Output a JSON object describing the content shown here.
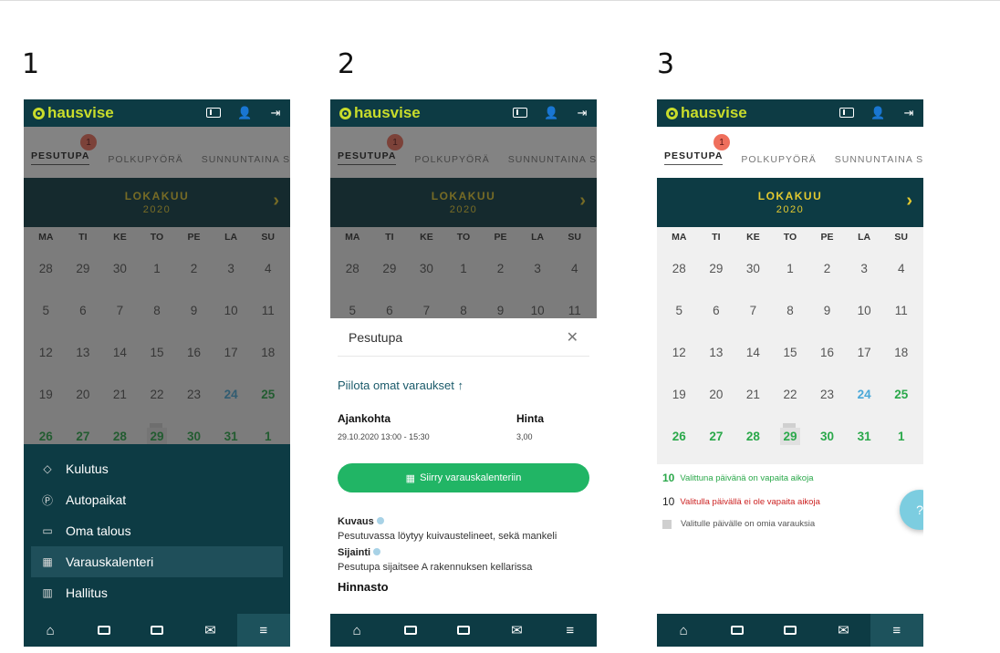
{
  "steps": [
    "1",
    "2",
    "3"
  ],
  "app": {
    "logo_text": "hausvise"
  },
  "tabs": [
    {
      "label": "PESUTUPA",
      "badge": "1"
    },
    {
      "label": "POLKUPYÖRÄ"
    },
    {
      "label": "SUNNUNTAINA SAUNA"
    }
  ],
  "calendar": {
    "month": "LOKAKUU",
    "year": "2020",
    "next_icon": "chevron-right-icon",
    "weekdays": [
      "MA",
      "TI",
      "KE",
      "TO",
      "PE",
      "LA",
      "SU"
    ],
    "weeks": [
      [
        "28",
        "29",
        "30",
        "1",
        "2",
        "3",
        "4"
      ],
      [
        "5",
        "6",
        "7",
        "8",
        "9",
        "10",
        "11"
      ],
      [
        "12",
        "13",
        "14",
        "15",
        "16",
        "17",
        "18"
      ],
      [
        "19",
        "20",
        "21",
        "22",
        "23",
        "24",
        "25"
      ],
      [
        "26",
        "27",
        "28",
        "29",
        "30",
        "31",
        "1"
      ]
    ]
  },
  "legend": {
    "free_num": "10",
    "free_text": "Valittuna päivänä on vapaita aikoja",
    "busy_num": "10",
    "busy_text": "Valitulla päivällä ei ole vapaita aikoja",
    "own_text": "Valitulle päivälle on omia varauksia"
  },
  "fab": {
    "label": "?"
  },
  "drawer": {
    "items": [
      {
        "label": "Kulutus",
        "icon": "drop-icon"
      },
      {
        "label": "Autopaikat",
        "icon": "parking-icon"
      },
      {
        "label": "Oma talous",
        "icon": "money-icon"
      },
      {
        "label": "Varauskalenteri",
        "icon": "calendar-icon"
      },
      {
        "label": "Hallitus",
        "icon": "bank-icon"
      }
    ]
  },
  "sheet": {
    "title": "Pesutupa",
    "hide_link": "Piilota omat varaukset ↑",
    "col_time": "Ajankohta",
    "col_price": "Hinta",
    "time_value": "29.10.2020 13:00 - 15:30",
    "price_value": "3,00",
    "cta": "Siirry varauskalenteriin",
    "desc_title": "Kuvaus",
    "desc_text": "Pesutuvassa löytyy kuivaustelineet, sekä mankeli",
    "loc_title": "Sijainti",
    "loc_text": "Pesutupa sijaitsee A rakennuksen kellarissa",
    "pricing_title": "Hinnasto"
  },
  "colors": {
    "header": "#0d3b44",
    "accent_yellow": "#e3c930",
    "logo_green": "#c9dc2b",
    "free_green": "#2aa84a",
    "weekend_blue": "#4aa8d8",
    "badge": "#ef6f5c",
    "cta_green": "#21b565"
  }
}
